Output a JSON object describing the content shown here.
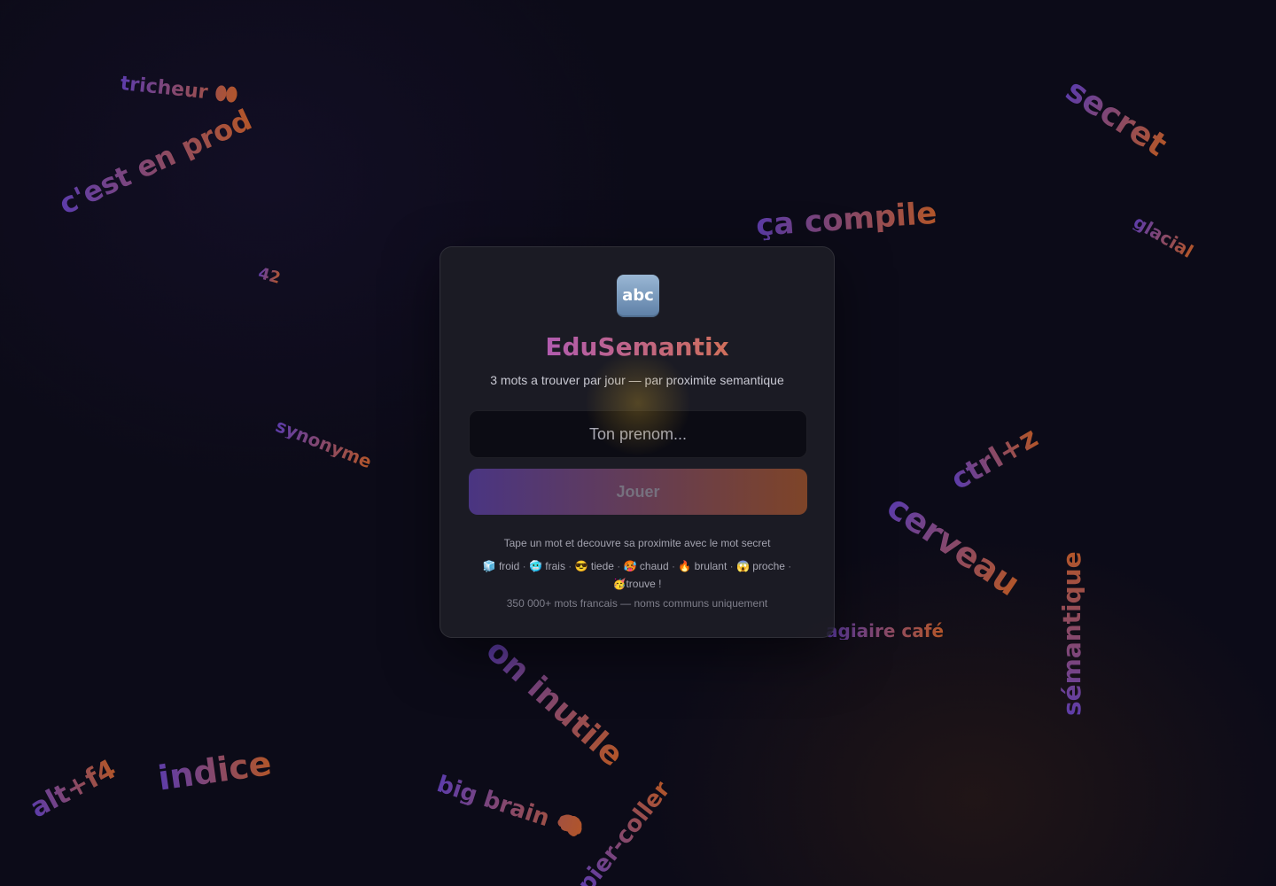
{
  "background_words": [
    "tricheur 👀",
    "c'est en prod",
    "42",
    "synonyme",
    "ça compile",
    "secret",
    "glacial",
    "ctrl+z",
    "cerveau",
    "sémantique",
    "agiaire café",
    "on inutile",
    "big brain 🧠",
    "pier-coller",
    "indice",
    "alt+f4"
  ],
  "app": {
    "logo_text": "abc",
    "title": "EduSemantix",
    "subtitle": "3 mots a trouver par jour — par proximite semantique"
  },
  "form": {
    "name_placeholder": "Ton prenom...",
    "name_value": "",
    "play_label": "Jouer"
  },
  "info": {
    "hint": "Tape un mot et decouvre sa proximite avec le mot secret",
    "levels": [
      {
        "emoji": "🧊",
        "label": "froid"
      },
      {
        "emoji": "🥶",
        "label": "frais"
      },
      {
        "emoji": "😎",
        "label": "tiede"
      },
      {
        "emoji": "🥵",
        "label": "chaud"
      },
      {
        "emoji": "🔥",
        "label": "brulant"
      },
      {
        "emoji": "😱",
        "label": "proche"
      },
      {
        "emoji": "🥳",
        "label": "trouve !"
      }
    ],
    "stats": "350 000+ mots francais — noms communs uniquement"
  },
  "colors": {
    "background": "#0c0b18",
    "card": "#1e1e26",
    "gradient_start": "#a050e0",
    "gradient_end": "#e07a2a"
  }
}
